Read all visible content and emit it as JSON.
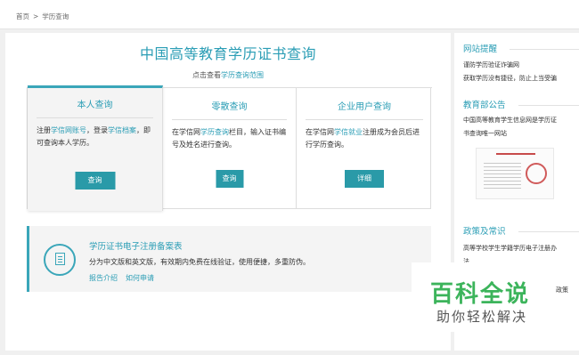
{
  "breadcrumb": {
    "home": "首页",
    "separator": ">",
    "current": "学历查询"
  },
  "main": {
    "title": "中国高等教育学历证书查询",
    "subtitle_prefix": "点击查看",
    "subtitle_link": "学历查询范围"
  },
  "cards": [
    {
      "title": "本人查询",
      "text_parts": [
        "注册",
        "学信网账号",
        "，登录",
        "学信档案",
        "，即可查询本人学历。"
      ],
      "button": "查询"
    },
    {
      "title": "零散查询",
      "text_parts": [
        "在学信网",
        "学历查询",
        "栏目，输入证书编号及姓名进行查询。"
      ],
      "button": "查询"
    },
    {
      "title": "企业用户查询",
      "text_parts": [
        "在学信网",
        "学信就业",
        "注册成为会员后进行学历查询。"
      ],
      "button": "详细"
    }
  ],
  "record": {
    "icon": "document-icon",
    "title": "学历证书电子注册备案表",
    "desc": "分为中文版和英文版，有效期内免费在线验证，使用便捷，多重防伪。",
    "links": [
      "报告介绍",
      "如何申请"
    ]
  },
  "sidebar": {
    "notice_title": "网站提醒",
    "notice_lines": [
      "谨防学历验证诈骗网",
      "获取学历没有捷径，防止上当受骗"
    ],
    "announce_title": "教育部公告",
    "announce_lines": [
      "中国高等教育学生信息网是学历证",
      "书查询唯一网站"
    ],
    "policy_title": "政策及常识",
    "policy_lines": [
      "高等学校学生学籍学历电子注册办",
      "法"
    ],
    "cut_text": "政策"
  },
  "watermark": {
    "main": "百科全说",
    "sub": "助你轻松解决"
  },
  "colors": {
    "accent": "#2a9db5",
    "button": "#2a9aa8",
    "watermark": "#3cb45b"
  }
}
